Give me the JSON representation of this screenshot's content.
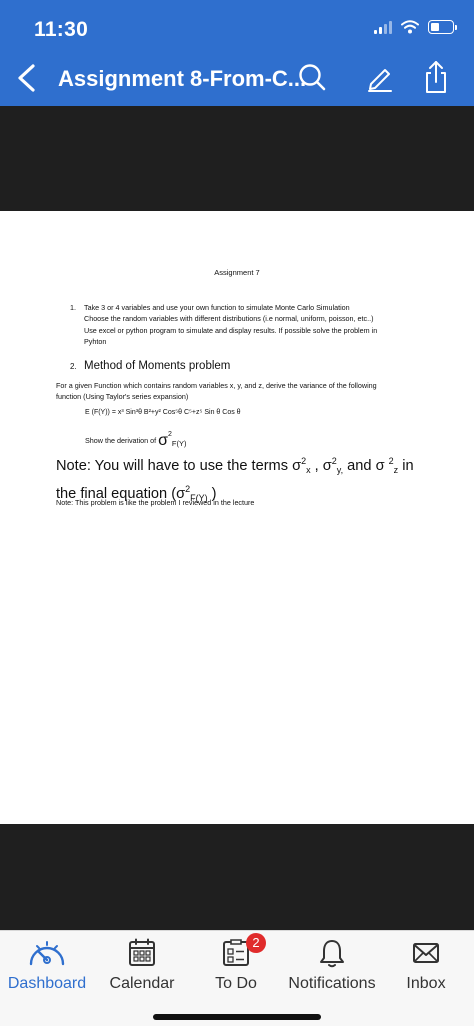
{
  "status_bar": {
    "time": "11:30"
  },
  "nav": {
    "title": "Assignment 8-From-C...",
    "back_icon": "chevron-left-icon",
    "search_icon": "search-icon",
    "annotate_icon": "pen-icon",
    "share_icon": "share-icon"
  },
  "document": {
    "heading": "Assignment 7",
    "item1": {
      "number": "1.",
      "lines": [
        "Take 3 or 4 variables and use your own function to simulate Monte Carlo Simulation",
        "Choose the random variables with different distributions (i.e normal, uniform, poisson, etc..)",
        "Use excel or python program to simulate and display results.  If possible solve the problem in",
        "Pyhton"
      ]
    },
    "item2": {
      "number": "2.",
      "title": "Method of Moments problem"
    },
    "description_lines": [
      "For a given Function which contains random variables x, y, and z, derive the variance of the following",
      "function (Using Taylor's series expansion)"
    ],
    "equation": "E (F(Y)) = x³ Sin³θ B²+y² Cos⁵θ C⁵+z⁵ Sin θ Cos θ",
    "derivation": {
      "prefix": "Show the derivation of ",
      "sigma": "σ",
      "sup": "2",
      "sub": "F(Y)"
    },
    "note_big": {
      "part1": "Note: You will have to use the terms σ",
      "x_sup": "2",
      "x_sub": "x",
      "part2": " , σ",
      "y_sup": "2",
      "y_sub": "y,",
      "part3": " and σ ",
      "z_sup": "2",
      "z_sub": "z",
      "part4": " in the final equation (σ",
      "f_sup": "2",
      "f_sub": "F(Y)",
      "part5": " )"
    },
    "note_small": "Note: This problem is like the problem I reviewed in the lecture"
  },
  "tabbar": {
    "accent": "#2f6fce",
    "tabs": [
      {
        "label": "Dashboard",
        "icon": "dashboard-gauge-icon",
        "active": true
      },
      {
        "label": "Calendar",
        "icon": "calendar-icon"
      },
      {
        "label": "To Do",
        "icon": "todo-icon",
        "badge": "2"
      },
      {
        "label": "Notifications",
        "icon": "bell-icon"
      },
      {
        "label": "Inbox",
        "icon": "envelope-icon"
      }
    ]
  }
}
